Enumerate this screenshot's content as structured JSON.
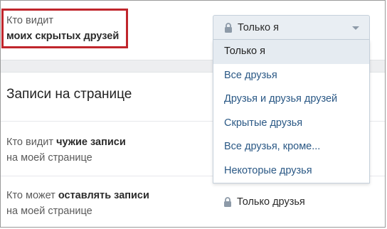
{
  "settings": {
    "hidden_friends": {
      "label_prefix": "Кто видит",
      "label_bold": "моих скрытых друзей",
      "selected": "Только я"
    },
    "section_title": "Записи на странице",
    "others_posts": {
      "label_prefix": "Кто видит ",
      "label_bold": "чужие записи",
      "label_suffix": "на моей странице"
    },
    "post_permission": {
      "label_prefix": "Кто может ",
      "label_bold": "оставлять записи",
      "label_suffix": "на моей странице",
      "value": "Только друзья"
    }
  },
  "dropdown": {
    "options": [
      "Только я",
      "Все друзья",
      "Друзья и друзья друзей",
      "Скрытые друзья",
      "Все друзья, кроме...",
      "Некоторые друзья"
    ],
    "active_index": 0
  },
  "colors": {
    "highlight": "#c0262c",
    "link": "#2a5885",
    "select_bg": "#e9eef3"
  }
}
